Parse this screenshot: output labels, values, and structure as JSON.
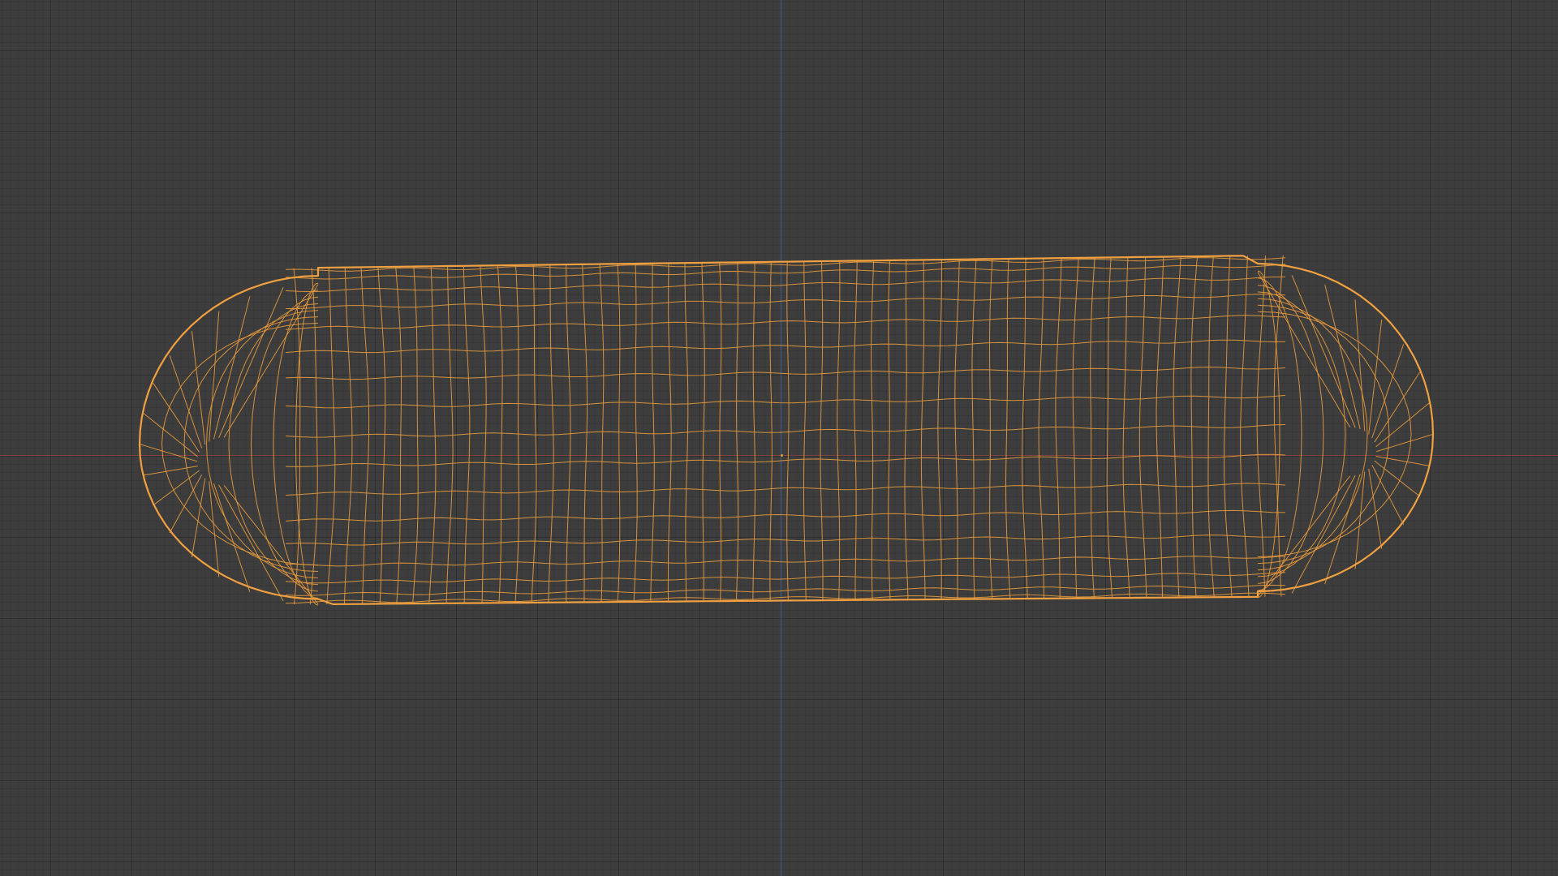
{
  "viewport": {
    "background_color": "#3d3d3d",
    "grid_minor_color": "#393939",
    "grid_major_color": "#353535"
  },
  "axes": {
    "x_axis_color": "#8a4540",
    "y_axis_color": "#3f5f8c"
  },
  "mesh": {
    "object_type": "wireframe-mesh",
    "selected": true,
    "wire_color": "#e89a3c",
    "outline_color": "#f0a040"
  },
  "origin": {
    "color": "#e89a3c"
  }
}
